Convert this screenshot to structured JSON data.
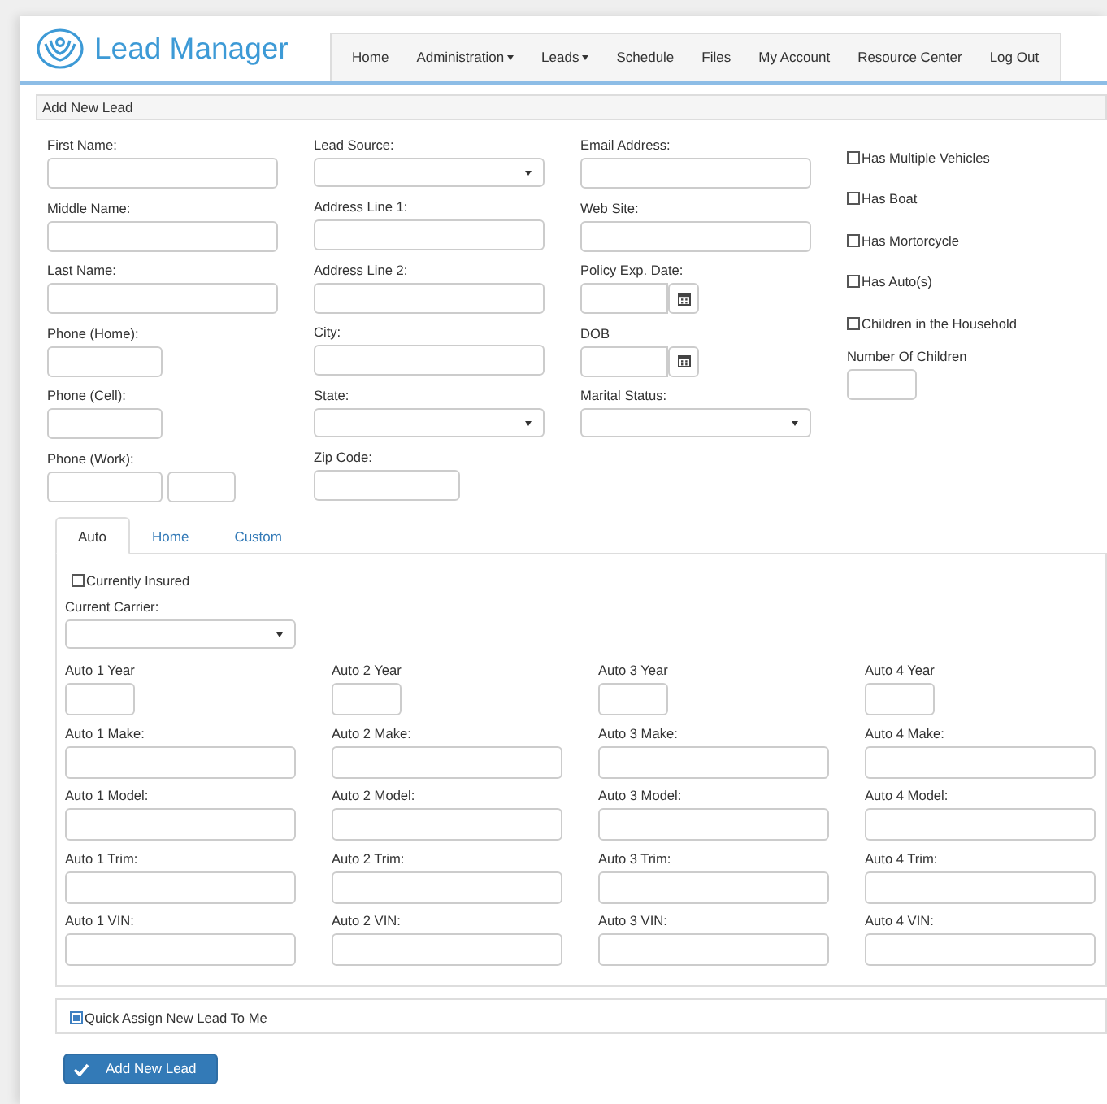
{
  "app": {
    "title": "Lead Manager"
  },
  "nav": [
    {
      "label": "Home",
      "dropdown": false
    },
    {
      "label": "Administration",
      "dropdown": true
    },
    {
      "label": "Leads",
      "dropdown": true
    },
    {
      "label": "Schedule",
      "dropdown": false
    },
    {
      "label": "Files",
      "dropdown": false
    },
    {
      "label": "My Account",
      "dropdown": false
    },
    {
      "label": "Resource Center",
      "dropdown": false
    },
    {
      "label": "Log Out",
      "dropdown": false
    }
  ],
  "panel": {
    "title": "Add New Lead"
  },
  "form_columns": [
    [
      {
        "kind": "text",
        "label": "First Name:"
      },
      {
        "kind": "text",
        "label": "Middle Name:"
      },
      {
        "kind": "text",
        "label": "Last Name:"
      },
      {
        "kind": "phone",
        "label": "Phone (Home):"
      },
      {
        "kind": "phone",
        "label": "Phone (Cell):"
      },
      {
        "kind": "phone_ext",
        "label": "Phone (Work):"
      }
    ],
    [
      {
        "kind": "select",
        "label": "Lead Source:"
      },
      {
        "kind": "text",
        "label": "Address Line 1:"
      },
      {
        "kind": "text",
        "label": "Address Line 2:"
      },
      {
        "kind": "text",
        "label": "City:"
      },
      {
        "kind": "select",
        "label": "State:"
      },
      {
        "kind": "zip",
        "label": "Zip Code:"
      }
    ],
    [
      {
        "kind": "text",
        "label": "Email Address:"
      },
      {
        "kind": "text",
        "label": "Web Site:"
      },
      {
        "kind": "date",
        "label": "Policy Exp. Date:"
      },
      {
        "kind": "date",
        "label": "DOB"
      },
      {
        "kind": "select",
        "label": "Marital Status:"
      }
    ],
    [
      {
        "kind": "checkbox",
        "label": "Has Multiple Vehicles",
        "checked": false
      },
      {
        "kind": "checkbox",
        "label": "Has Boat",
        "checked": false
      },
      {
        "kind": "checkbox",
        "label": "Has Mortorcycle",
        "checked": false
      },
      {
        "kind": "checkbox",
        "label": "Has Auto(s)",
        "checked": false
      },
      {
        "kind": "checkbox",
        "label": "Children in the Household",
        "checked": false
      },
      {
        "kind": "number",
        "label": "Number Of Children"
      }
    ]
  ],
  "tabs": [
    {
      "label": "Auto",
      "selected": true
    },
    {
      "label": "Home",
      "selected": false
    },
    {
      "label": "Custom",
      "selected": false
    }
  ],
  "auto_tab": {
    "insured": {
      "label": "Currently Insured",
      "checked": false
    },
    "carrier": {
      "label": "Current Carrier:"
    },
    "autos": [
      [
        {
          "kind": "year",
          "label": "Auto 1 Year"
        },
        {
          "kind": "text",
          "label": "Auto 1 Make:"
        },
        {
          "kind": "text",
          "label": "Auto 1 Model:"
        },
        {
          "kind": "text",
          "label": "Auto 1 Trim:"
        },
        {
          "kind": "text",
          "label": "Auto 1 VIN:"
        }
      ],
      [
        {
          "kind": "year",
          "label": "Auto 2 Year"
        },
        {
          "kind": "text",
          "label": "Auto 2 Make:"
        },
        {
          "kind": "text",
          "label": "Auto 2 Model:"
        },
        {
          "kind": "text",
          "label": "Auto 2 Trim:"
        },
        {
          "kind": "text",
          "label": "Auto 2 VIN:"
        }
      ],
      [
        {
          "kind": "year",
          "label": "Auto 3 Year"
        },
        {
          "kind": "text",
          "label": "Auto 3 Make:"
        },
        {
          "kind": "text",
          "label": "Auto 3 Model:"
        },
        {
          "kind": "text",
          "label": "Auto 3 Trim:"
        },
        {
          "kind": "text",
          "label": "Auto 3 VIN:"
        }
      ],
      [
        {
          "kind": "year",
          "label": "Auto 4 Year"
        },
        {
          "kind": "text",
          "label": "Auto 4 Make:"
        },
        {
          "kind": "text",
          "label": "Auto 4 Model:"
        },
        {
          "kind": "text",
          "label": "Auto 4 Trim:"
        },
        {
          "kind": "text",
          "label": "Auto 4 VIN:"
        }
      ]
    ]
  },
  "quick_assign": {
    "label": "Quick Assign New Lead To Me",
    "checked": true
  },
  "submit": {
    "label": "Add New Lead"
  }
}
